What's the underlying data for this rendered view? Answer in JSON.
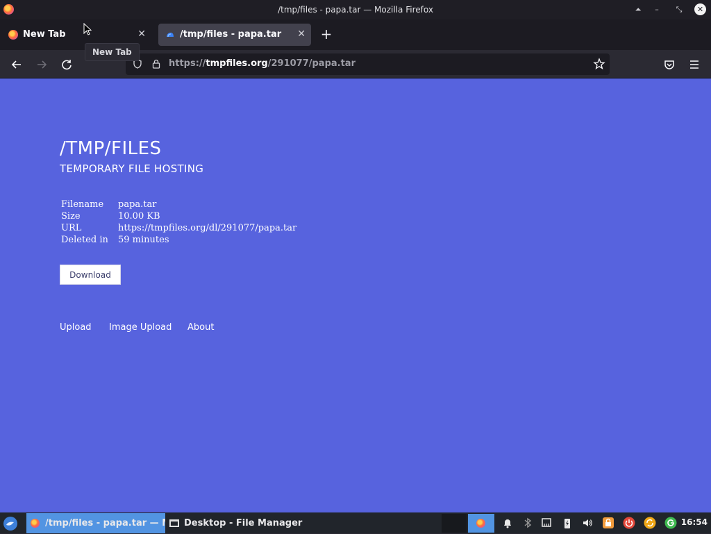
{
  "window": {
    "title": "/tmp/files - papa.tar — Mozilla Firefox"
  },
  "tabs": [
    {
      "label": "New Tab",
      "icon": "firefox-icon",
      "active": false
    },
    {
      "label": "/tmp/files - papa.tar",
      "icon": "tmpfiles-favicon",
      "active": true
    }
  ],
  "tooltip": "New Tab",
  "urlbar": {
    "prefix": "https://",
    "host": "tmpfiles.org",
    "path": "/291077/papa.tar"
  },
  "site": {
    "title": "/TMP/FILES",
    "subtitle": "TEMPORARY FILE HOSTING"
  },
  "file_info": [
    {
      "key": "Filename",
      "value": "papa.tar"
    },
    {
      "key": "Size",
      "value": "10.00 KB"
    },
    {
      "key": "URL",
      "value": "https://tmpfiles.org/dl/291077/papa.tar"
    },
    {
      "key": "Deleted in",
      "value": "59 minutes"
    }
  ],
  "download_label": "Download",
  "footer_links": [
    "Upload",
    "Image Upload",
    "About"
  ],
  "taskbar": {
    "tasks": [
      {
        "label": "/tmp/files - papa.tar — M...",
        "active": true
      },
      {
        "label": "Desktop - File Manager",
        "active": false
      }
    ],
    "clock": "16:54"
  },
  "colors": {
    "page_background": "#5763de",
    "browser_chrome": "#2b2a33",
    "taskbar_active": "#5294e2"
  }
}
